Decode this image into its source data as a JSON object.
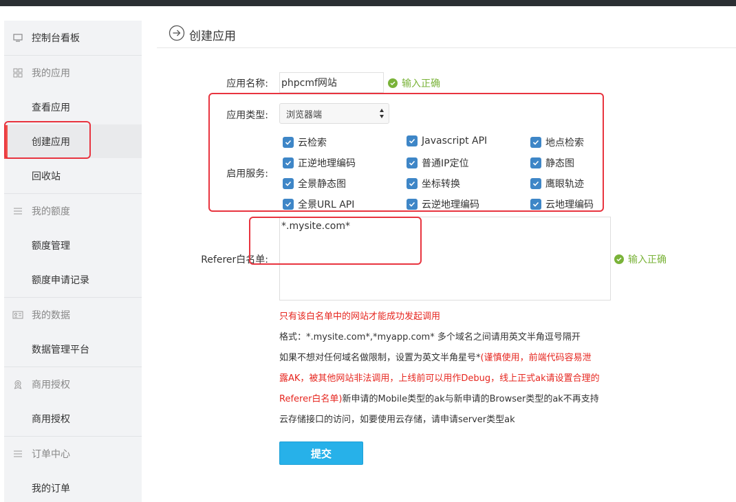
{
  "sidebar": {
    "items": [
      {
        "label": "控制台看板",
        "icon": "monitor-icon",
        "type": "link"
      },
      {
        "label": "我的应用",
        "icon": "grid-icon",
        "type": "group"
      },
      {
        "label": "查看应用",
        "type": "link"
      },
      {
        "label": "创建应用",
        "type": "link",
        "active": true
      },
      {
        "label": "回收站",
        "type": "link"
      },
      {
        "label": "我的额度",
        "icon": "list-icon",
        "type": "group"
      },
      {
        "label": "额度管理",
        "type": "link"
      },
      {
        "label": "额度申请记录",
        "type": "link"
      },
      {
        "label": "我的数据",
        "icon": "id-card-icon",
        "type": "group"
      },
      {
        "label": "数据管理平台",
        "type": "link"
      },
      {
        "label": "商用授权",
        "icon": "badge-icon",
        "type": "group"
      },
      {
        "label": "商用授权",
        "type": "link"
      },
      {
        "label": "订单中心",
        "icon": "list-icon",
        "type": "group"
      },
      {
        "label": "我的订单",
        "type": "link"
      }
    ]
  },
  "header": {
    "title": "创建应用",
    "icon": "arrow-right-circle-icon"
  },
  "form": {
    "app_name": {
      "label": "应用名称:",
      "value": "phpcmf网站",
      "ok": "输入正确"
    },
    "app_type": {
      "label": "应用类型:",
      "selected": "浏览器端"
    },
    "services": {
      "label": "启用服务:",
      "items": [
        {
          "label": "云检索",
          "checked": true
        },
        {
          "label": "Javascript API",
          "checked": true
        },
        {
          "label": "地点检索",
          "checked": true
        },
        {
          "label": "正逆地理编码",
          "checked": true
        },
        {
          "label": "普通IP定位",
          "checked": true
        },
        {
          "label": "静态图",
          "checked": true
        },
        {
          "label": "全景静态图",
          "checked": true
        },
        {
          "label": "坐标转换",
          "checked": true
        },
        {
          "label": "鹰眼轨迹",
          "checked": true
        },
        {
          "label": "全景URL API",
          "checked": true
        },
        {
          "label": "云逆地理编码",
          "checked": true
        },
        {
          "label": "云地理编码",
          "checked": true
        }
      ]
    },
    "referer": {
      "label": "Referer白名单:",
      "value": "*.mysite.com*",
      "ok": "输入正确"
    },
    "notes": {
      "red_line": "只有该白名单中的网站才能成功发起调用",
      "format_line": "格式：*.mysite.com*,*myapp.com* 多个域名之间请用英文半角逗号隔开",
      "line3_prefix": "如果不想对任何域名做限制，设置为英文半角星号*",
      "line3_red": "(谨慎使用，前端代码容易泄",
      "line4_red": "露AK，被其他网站非法调用，上线前可以用作Debug，线上正式ak请设置合理的",
      "line5_red": "Referer白名单)",
      "line5_rest": "新申请的Mobile类型的ak与新申请的Browser类型的ak不再支持",
      "line6": "云存储接口的访问，如要使用云存储，请申请server类型ak"
    },
    "submit_label": "提交"
  },
  "colors": {
    "accent": "#27b1e9",
    "ok": "#7ab339",
    "warning": "#e6261f",
    "checkbox": "#3e86c7",
    "highlight": "#e8333e"
  }
}
